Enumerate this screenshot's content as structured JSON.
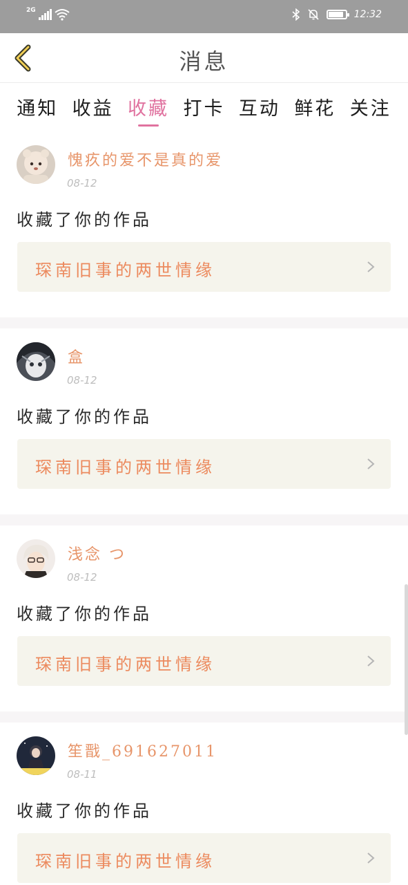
{
  "status_bar": {
    "network": "2G",
    "time": "12:32",
    "battery_level": 0.9
  },
  "header": {
    "title": "消息",
    "back_icon": "chevron-left-icon"
  },
  "tabs": [
    {
      "label": "通知",
      "active": false
    },
    {
      "label": "收益",
      "active": false
    },
    {
      "label": "收藏",
      "active": true
    },
    {
      "label": "打卡",
      "active": false
    },
    {
      "label": "互动",
      "active": false
    },
    {
      "label": "鲜花",
      "active": false
    },
    {
      "label": "关注",
      "active": false
    }
  ],
  "notifications": [
    {
      "username": "愧疚的爱不是真的爱",
      "date": "08-12",
      "action": "收藏了你的作品",
      "work_title": "琛南旧事的两世情缘"
    },
    {
      "username": "盒",
      "date": "08-12",
      "action": "收藏了你的作品",
      "work_title": "琛南旧事的两世情缘"
    },
    {
      "username": "浅念 つ",
      "date": "08-12",
      "action": "收藏了你的作品",
      "work_title": "琛南旧事的两世情缘"
    },
    {
      "username": "笙戬_691627011",
      "date": "08-11",
      "action": "收藏了你的作品",
      "work_title": "琛南旧事的两世情缘"
    }
  ],
  "colors": {
    "accent": "#e0729f",
    "username": "#e7956a",
    "work_title": "#ec8a5e",
    "work_box_bg": "#f5f4ec",
    "status_bar_bg": "#9d9d9d"
  }
}
